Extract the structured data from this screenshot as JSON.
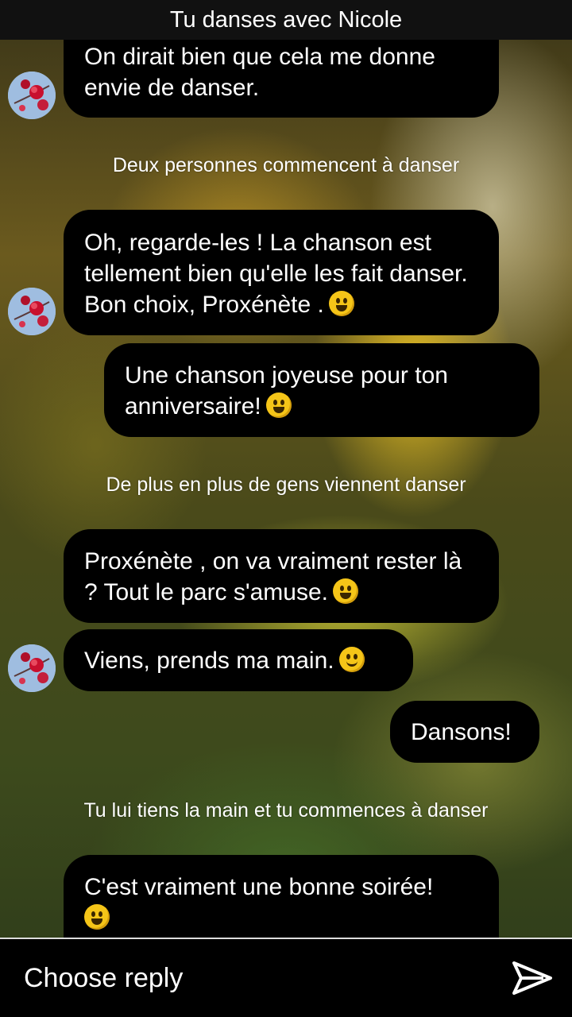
{
  "header": {
    "title": "Tu danses avec Nicole"
  },
  "messages": [
    {
      "text": "On dirait bien que cela me donne envie de danser.",
      "emoji": ""
    },
    {
      "text": "Oh, regarde-les ! La chanson est tellement bien qu'elle les fait danser. Bon choix, Proxénète .",
      "emoji": "grinning-face-icon"
    },
    {
      "text": "Une chanson joyeuse pour ton anniversaire!",
      "emoji": "grinning-face-icon"
    },
    {
      "text": "Proxénète , on va vraiment rester là ? Tout le parc s'amuse.",
      "emoji": "tears-of-joy-icon"
    },
    {
      "text": "Viens, prends ma main.",
      "emoji": "smiling-face-icon"
    },
    {
      "text": "Dansons!",
      "emoji": ""
    },
    {
      "text": "C'est vraiment une bonne soirée!",
      "emoji": "grinning-smiling-eyes-icon"
    }
  ],
  "narration": [
    "Deux personnes commencent à danser",
    "De plus en plus de gens viennent danser",
    "Tu lui tiens la main et tu commences à danser"
  ],
  "footer": {
    "reply_label": "Choose reply",
    "send_icon": "send-icon"
  }
}
